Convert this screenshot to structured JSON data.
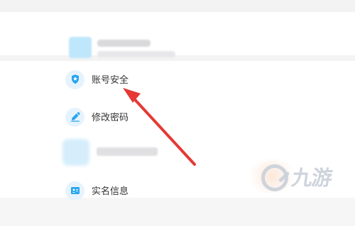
{
  "menu": {
    "items": [
      {
        "label": "账号安全",
        "icon": "shield-icon"
      },
      {
        "label": "修改密码",
        "icon": "pencil-icon"
      },
      {
        "label": "实名信息",
        "icon": "id-card-icon"
      }
    ]
  },
  "watermark": {
    "text": "九游"
  },
  "colors": {
    "accent_blue": "#27a6ef",
    "arrow_red": "#e53935",
    "background": "#f3f3f4",
    "surface": "#ffffff"
  }
}
